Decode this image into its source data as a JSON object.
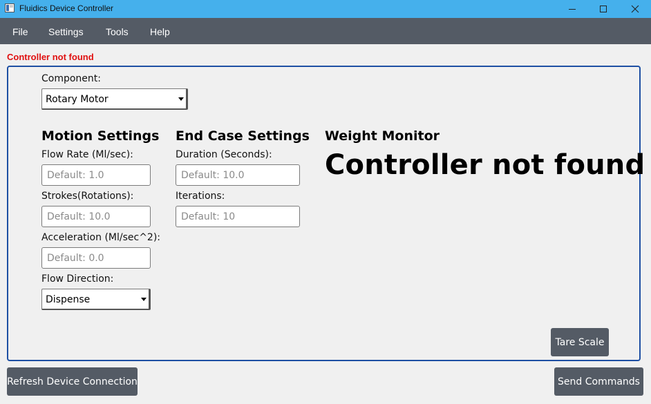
{
  "window": {
    "title": "Fluidics Device Controller",
    "icons": [
      "app-icon",
      "minimize-icon",
      "maximize-icon",
      "close-icon"
    ]
  },
  "menu": {
    "file": "File",
    "settings": "Settings",
    "tools": "Tools",
    "help": "Help"
  },
  "status": {
    "message": "Controller not found",
    "color": "#e01010"
  },
  "component": {
    "label": "Component:",
    "selected": "Rotary Motor"
  },
  "motion": {
    "heading": "Motion Settings",
    "flow_rate_label": "Flow Rate (Ml/sec):",
    "flow_rate_placeholder": "Default: 1.0",
    "strokes_label": "Strokes(Rotations):",
    "strokes_placeholder": "Default: 10.0",
    "acceleration_label": "Acceleration (Ml/sec^2):",
    "acceleration_placeholder": "Default: 0.0",
    "direction_label": "Flow Direction:",
    "direction_selected": "Dispense"
  },
  "end_case": {
    "heading": "End Case Settings",
    "duration_label": "Duration (Seconds):",
    "duration_placeholder": "Default: 10.0",
    "iterations_label": "Iterations:",
    "iterations_placeholder": "Default: 10"
  },
  "weight": {
    "heading": "Weight Monitor",
    "reading": "Controller not found",
    "tare_label": "Tare Scale"
  },
  "footer": {
    "refresh_label": "Refresh Device Connection",
    "send_label": "Send Commands"
  },
  "colors": {
    "titlebar": "#45b0ec",
    "menubar": "#545b65",
    "panel_border": "#1d4fa3",
    "button": "#545b65"
  }
}
